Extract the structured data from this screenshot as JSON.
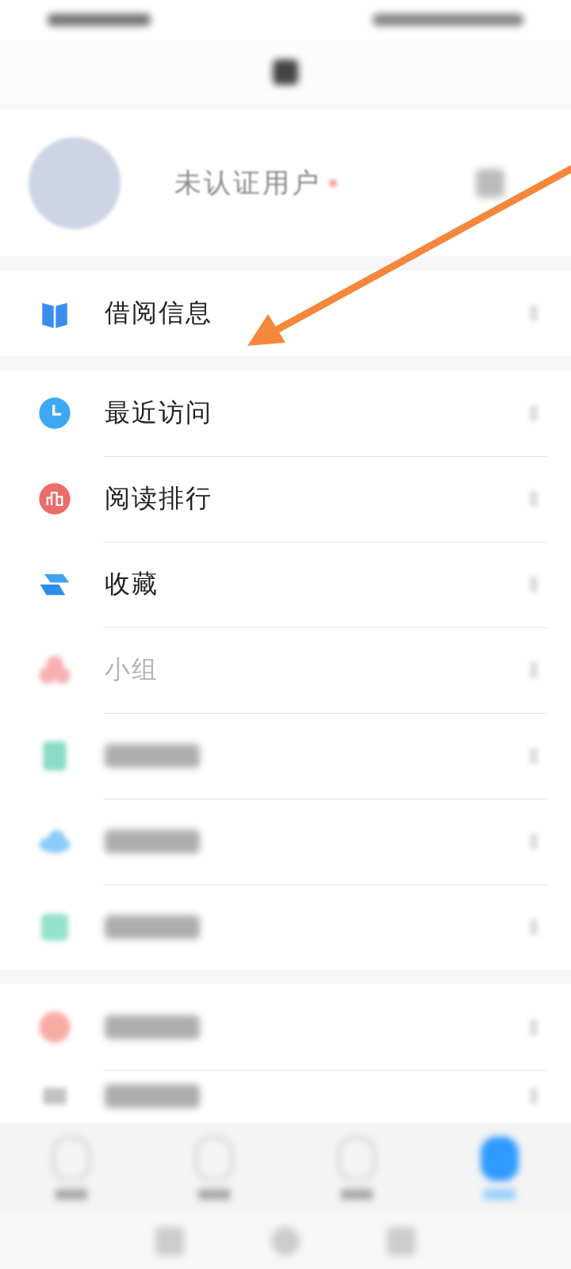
{
  "profile": {
    "name": "未认证用户"
  },
  "menu_groups": [
    {
      "items": [
        {
          "label": "借阅信息",
          "faded": false
        }
      ]
    },
    {
      "items": [
        {
          "label": "最近访问",
          "faded": false
        },
        {
          "label": "阅读排行",
          "faded": false
        },
        {
          "label": "收藏",
          "faded": false
        },
        {
          "label": "小组",
          "faded": true
        },
        {
          "faded": true
        },
        {
          "faded": true
        },
        {
          "faded": true
        }
      ]
    },
    {
      "items": [
        {
          "faded": true
        },
        {
          "faded": true
        }
      ]
    }
  ],
  "tab_bar": [
    {
      "selected": false
    },
    {
      "selected": false
    },
    {
      "selected": false
    },
    {
      "selected": true
    }
  ]
}
